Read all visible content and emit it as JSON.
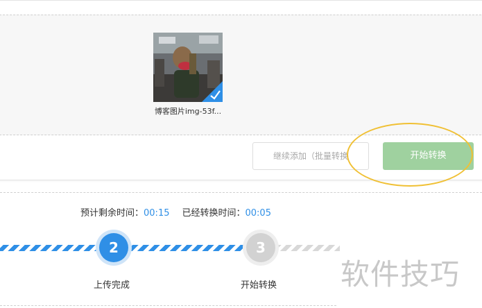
{
  "upload": {
    "file": {
      "name": "博客图片img-53f...",
      "selected": true
    },
    "add_button_label": "继续添加（批量转换",
    "start_button_label": "开始转换"
  },
  "progress": {
    "remaining_label": "预计剩余时间：",
    "remaining_value": "00:15",
    "elapsed_label": "已经转换时间：",
    "elapsed_value": "00:05"
  },
  "steps": [
    {
      "number": "2",
      "label": "上传完成",
      "state": "done"
    },
    {
      "number": "3",
      "label": "开始转换",
      "state": "pending"
    }
  ],
  "watermark": "软件技巧",
  "colors": {
    "accent_blue": "#2f8fe6",
    "start_button": "#9fd19f",
    "highlight_ellipse": "#f0c034"
  }
}
